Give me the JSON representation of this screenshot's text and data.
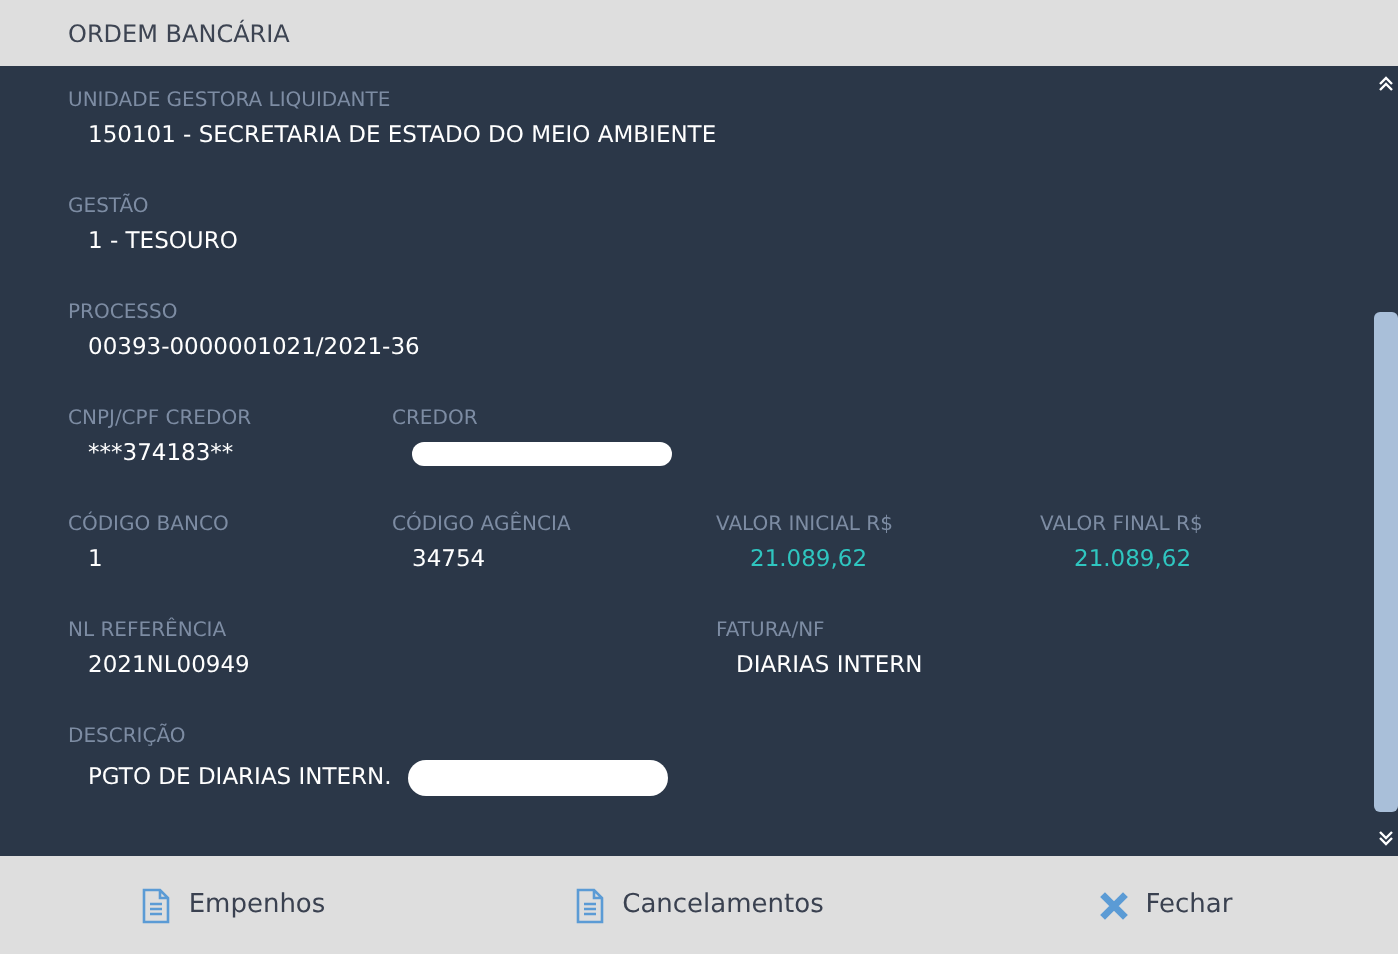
{
  "window": {
    "title": "ORDEM BANCÁRIA"
  },
  "rows": [
    {
      "kind": "wide",
      "fields": [
        {
          "label": "UNIDADE GESTORA LIQUIDANTE",
          "kind": "text",
          "value": "150101 - SECRETARIA DE ESTADO DO MEIO AMBIENTE"
        }
      ]
    },
    {
      "kind": "wide",
      "fields": [
        {
          "label": "GESTÃO",
          "kind": "text",
          "value": "1 - TESOURO"
        }
      ]
    },
    {
      "kind": "wide",
      "fields": [
        {
          "label": "PROCESSO",
          "kind": "text",
          "value": "00393-0000001021/2021-36"
        }
      ]
    },
    {
      "kind": "quarter",
      "fields": [
        {
          "label": "CNPJ/CPF CREDOR",
          "kind": "text",
          "value": "***374183**"
        },
        {
          "label": "CREDOR",
          "kind": "redacted"
        }
      ]
    },
    {
      "kind": "quarter",
      "fields": [
        {
          "label": "CÓDIGO BANCO",
          "kind": "text",
          "value": "1"
        },
        {
          "label": "CÓDIGO AGÊNCIA",
          "kind": "text",
          "value": "34754"
        },
        {
          "label": "VALOR INICIAL R$",
          "kind": "money",
          "value": "21.089,62"
        },
        {
          "label": "VALOR FINAL R$",
          "kind": "money",
          "value": "21.089,62"
        }
      ]
    },
    {
      "kind": "half",
      "fields": [
        {
          "label": "NL REFERÊNCIA",
          "kind": "text",
          "value": "2021NL00949"
        },
        {
          "label": "FATURA/NF",
          "kind": "text",
          "value": "DIARIAS INTERN"
        }
      ]
    },
    {
      "kind": "wide",
      "fields": [
        {
          "label": "DESCRIÇÃO",
          "kind": "redacted_tail",
          "value": "PGTO DE DIARIAS INTERN."
        }
      ]
    }
  ],
  "buttons": [
    {
      "label": "Empenhos",
      "kind": "document"
    },
    {
      "label": "Cancelamentos",
      "kind": "document"
    },
    {
      "label": "Fechar",
      "kind": "close"
    }
  ]
}
